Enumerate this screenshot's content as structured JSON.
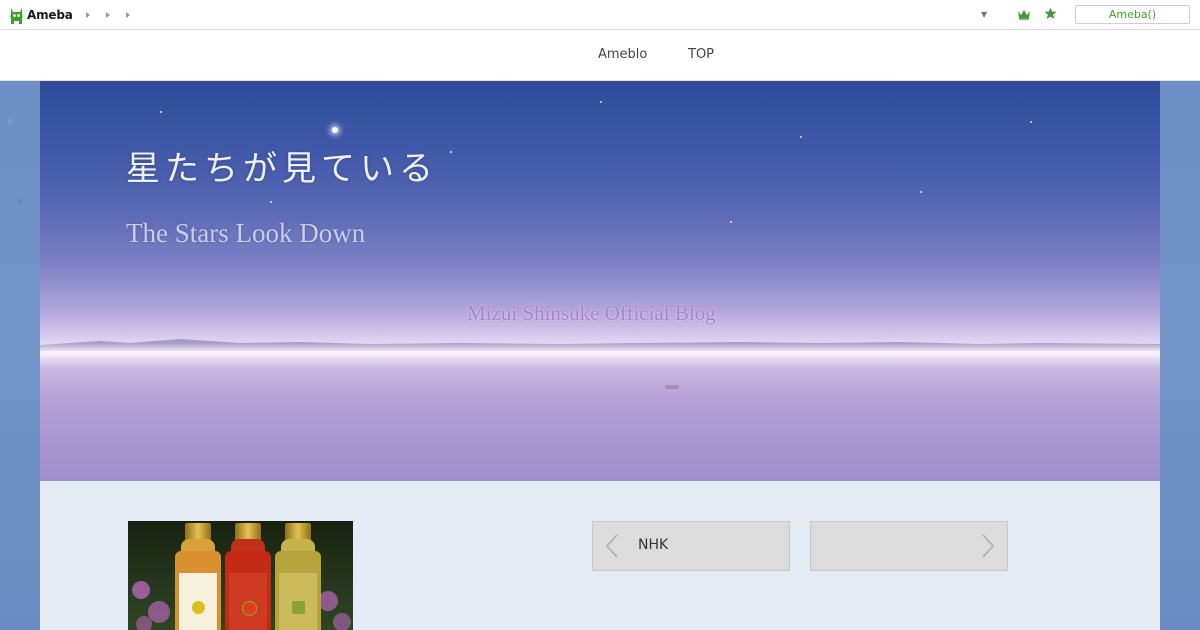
{
  "topbar": {
    "logo_text": "Ameba",
    "user_button": "Ameba()"
  },
  "nav": {
    "links": [
      "Ameblo",
      "TOP"
    ]
  },
  "header": {
    "title_jp": "星たちが見ている",
    "title_en": "The Stars Look Down",
    "subtitle": "Mizui Shinsuke Official Blog"
  },
  "pager": {
    "prev_label": "NHK",
    "next_label": ""
  },
  "colors": {
    "accent_green": "#3f9e2f",
    "sky_top": "#2f4a9a",
    "subtitle_purple": "#a883d0",
    "content_bg": "#e4ebf4"
  },
  "icons": {
    "logo": "ameba-monster-icon",
    "menu_arrows": "triangle-right-icon",
    "dropdown": "caret-down-icon",
    "crown": "crown-icon",
    "star": "star-icon",
    "prev": "chevron-left-icon",
    "next": "chevron-right-icon"
  }
}
